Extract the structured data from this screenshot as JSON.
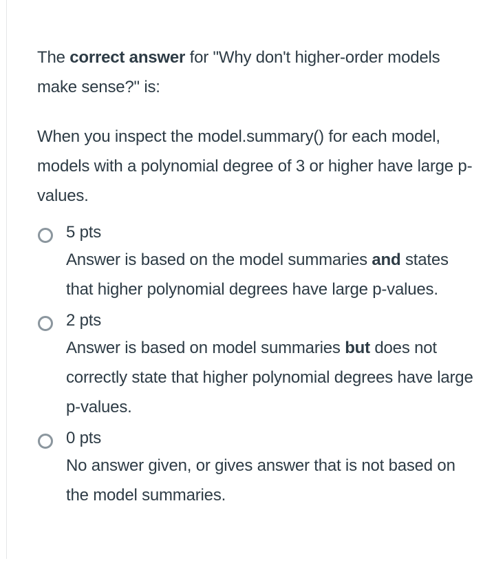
{
  "question": {
    "intro_prefix": "The ",
    "intro_bold": "correct answer",
    "intro_suffix": " for \"Why don't higher-order models make sense?\" is:",
    "correct_answer": "When you inspect the model.summary() for each model, models with a polynomial degree of 3 or higher have large p-values."
  },
  "rubric": {
    "options": [
      {
        "points": "5 pts",
        "desc_before": "Answer is based on the model summaries ",
        "desc_bold": "and",
        "desc_after": " states that higher polynomial degrees have large p-values."
      },
      {
        "points": "2 pts",
        "desc_before": "Answer is based on model summaries ",
        "desc_bold": "but",
        "desc_after": " does not correctly state that higher polynomial degrees have large p-values."
      },
      {
        "points": "0 pts",
        "desc_before": "No answer given, or gives answer that is not based on the model summaries.",
        "desc_bold": "",
        "desc_after": ""
      }
    ]
  }
}
